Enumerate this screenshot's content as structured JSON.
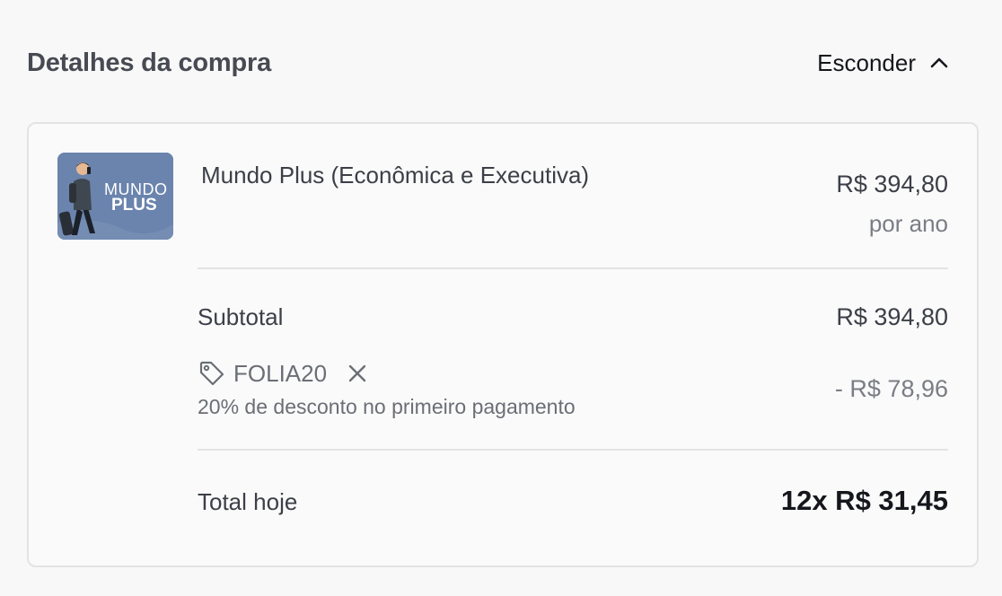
{
  "header": {
    "title": "Detalhes da compra",
    "toggle_label": "Esconder",
    "toggle_icon": "chevron-up-icon"
  },
  "product": {
    "thumbnail_icon": "product-thumbnail",
    "thumbnail_text_top": "MUNDO",
    "thumbnail_text_bottom": "PLUS",
    "name": "Mundo Plus (Econômica e Executiva)",
    "price": "R$ 394,80",
    "period": "por ano"
  },
  "summary": {
    "subtotal_label": "Subtotal",
    "subtotal_value": "R$ 394,80",
    "coupon_icon": "tag-icon",
    "coupon_code": "FOLIA20",
    "coupon_remove_icon": "close-icon",
    "coupon_description": "20% de desconto no primeiro pagamento",
    "discount_value": "- R$ 78,96",
    "total_label": "Total hoje",
    "total_value": "12x R$ 31,45"
  },
  "colors": {
    "background": "#f8f8f8",
    "card_border": "#e3e3e5",
    "thumbnail_bg": "#6b84ad",
    "text_primary": "#15171c",
    "text_muted": "#7a7d84"
  }
}
